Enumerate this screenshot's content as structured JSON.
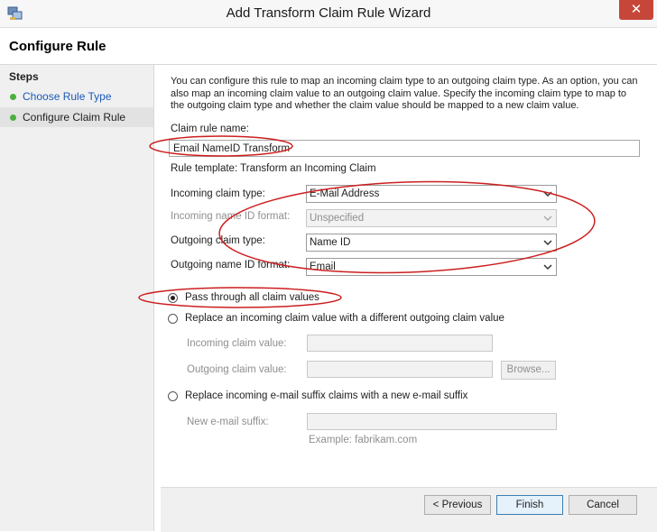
{
  "window": {
    "title": "Add Transform Claim Rule Wizard",
    "close_label": "✕"
  },
  "header": {
    "title": "Configure Rule"
  },
  "steps": {
    "title": "Steps",
    "items": [
      {
        "label": "Choose Rule Type"
      },
      {
        "label": "Configure Claim Rule"
      }
    ]
  },
  "main": {
    "intro": "You can configure this rule to map an incoming claim type to an outgoing claim type. As an option, you can also map an incoming claim value to an outgoing claim value. Specify the incoming claim type to map to the outgoing claim type and whether the claim value should be mapped to a new claim value.",
    "claim_rule_name_label": "Claim rule name:",
    "claim_rule_name_value": "Email NameID Transform",
    "rule_template": "Rule template: Transform an Incoming Claim",
    "incoming_claim_type_label": "Incoming claim type:",
    "incoming_claim_type_value": "E-Mail Address",
    "incoming_name_id_format_label": "Incoming name ID format:",
    "incoming_name_id_format_value": "Unspecified",
    "outgoing_claim_type_label": "Outgoing claim type:",
    "outgoing_claim_type_value": "Name ID",
    "outgoing_name_id_format_label": "Outgoing name ID format:",
    "outgoing_name_id_format_value": "Email",
    "pass_through_label": "Pass through all claim values",
    "replace_value_label": "Replace an incoming claim value with a different outgoing claim value",
    "incoming_claim_value_label": "Incoming claim value:",
    "outgoing_claim_value_label": "Outgoing claim value:",
    "browse_label": "Browse...",
    "replace_suffix_label": "Replace incoming e-mail suffix claims with a new e-mail suffix",
    "new_suffix_label": "New e-mail suffix:",
    "example_text": "Example: fabrikam.com"
  },
  "footer": {
    "previous_label": "< Previous",
    "finish_label": "Finish",
    "cancel_label": "Cancel"
  },
  "colors": {
    "annotation": "#cc1f1f",
    "link": "#1a58b8",
    "step_dot": "#4caf3f"
  }
}
